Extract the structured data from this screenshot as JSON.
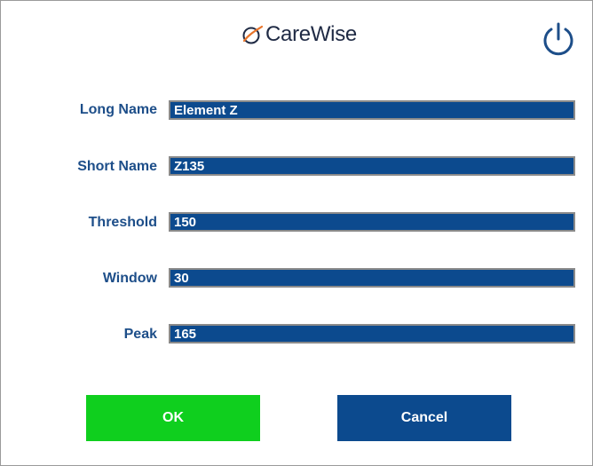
{
  "header": {
    "logo_text": "CareWise",
    "power_icon": "power-icon"
  },
  "form": {
    "fields": [
      {
        "label": "Long Name",
        "value": "Element Z"
      },
      {
        "label": "Short Name",
        "value": "Z135"
      },
      {
        "label": "Threshold",
        "value": "150"
      },
      {
        "label": "Window",
        "value": "30"
      },
      {
        "label": "Peak",
        "value": "165"
      }
    ]
  },
  "buttons": {
    "ok_label": "OK",
    "cancel_label": "Cancel"
  },
  "colors": {
    "accent_blue": "#0c4a8e",
    "label_blue": "#1d4e89",
    "ok_green": "#0fcf1e",
    "logo_orange": "#e8742a"
  }
}
